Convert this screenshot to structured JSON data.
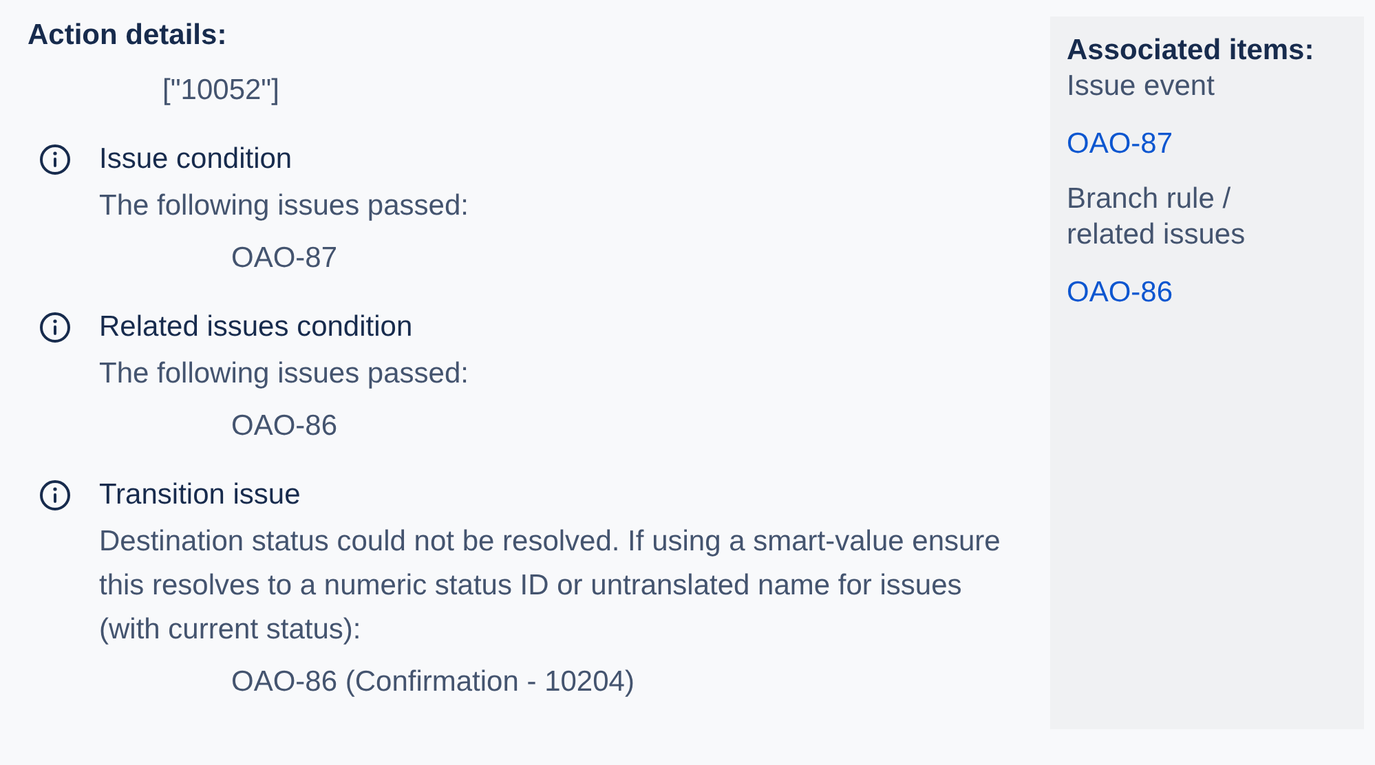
{
  "action_details": {
    "title": "Action details:",
    "value": "[\"10052\"]"
  },
  "entries": [
    {
      "title": "Issue condition",
      "message": "The following issues passed:",
      "items": [
        "OAO-87"
      ]
    },
    {
      "title": "Related issues condition",
      "message": "The following issues passed:",
      "items": [
        "OAO-86"
      ]
    },
    {
      "title": "Transition issue",
      "message": "Destination status could not be resolved. If using a smart-value ensure this resolves to a numeric status ID or untranslated name for issues (with current status):",
      "items": [
        "OAO-86 (Confirmation - 10204)"
      ]
    }
  ],
  "associated_items": {
    "title": "Associated items:",
    "groups": [
      {
        "label": "Issue event",
        "link": "OAO-87"
      },
      {
        "label": "Branch rule / related issues",
        "link": "OAO-86"
      }
    ]
  }
}
